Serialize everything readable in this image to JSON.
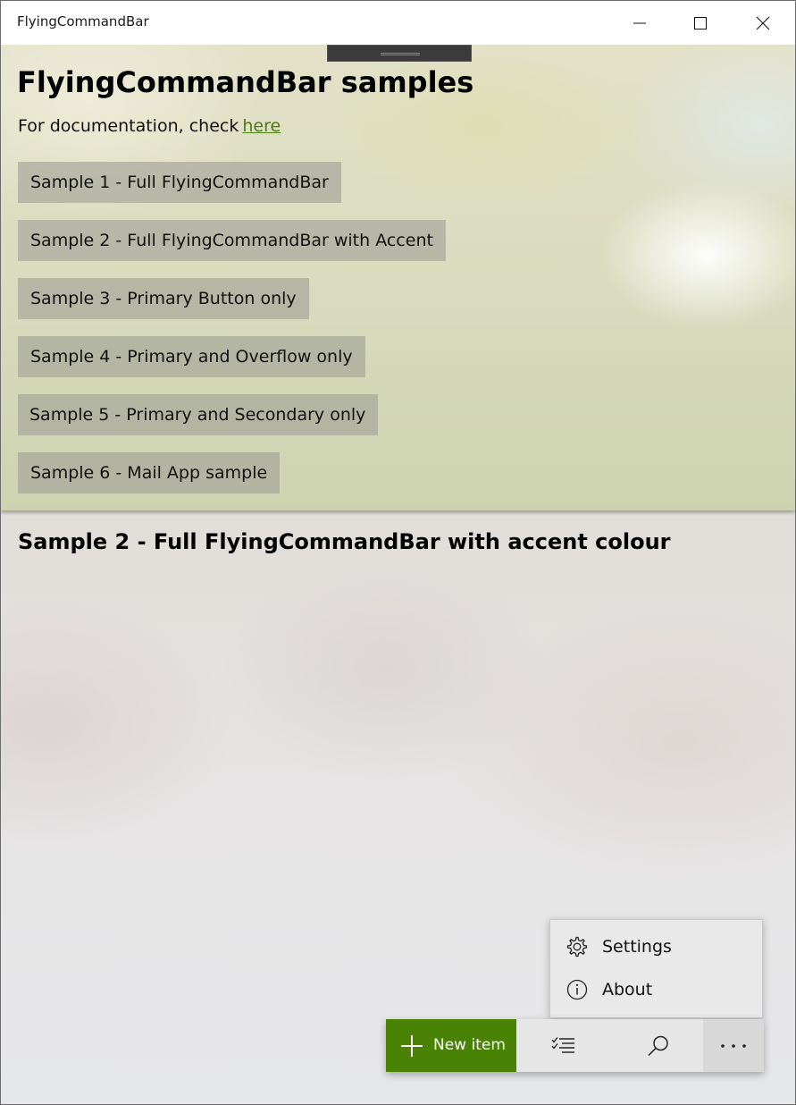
{
  "window": {
    "title": "FlyingCommandBar",
    "controls": [
      "minimize-icon",
      "maximize-icon",
      "close-icon"
    ]
  },
  "pane": {
    "heading": "FlyingCommandBar samples",
    "doc_prefix": "For documentation, check",
    "doc_link": "here",
    "samples": [
      "Sample 1 - Full FlyingCommandBar",
      "Sample 2 - Full FlyingCommandBar with Accent",
      "Sample 3 - Primary Button only",
      "Sample 4 - Primary and Overflow only",
      "Sample 5 - Primary and Secondary only",
      "Sample 6 - Mail App sample"
    ]
  },
  "content": {
    "section_title": "Sample 2 - Full FlyingCommandBar with accent colour"
  },
  "overflow_menu": {
    "items": [
      {
        "label": "Settings",
        "icon": "gear-icon"
      },
      {
        "label": "About",
        "icon": "info-icon"
      }
    ]
  },
  "command_bar": {
    "primary_label": "New item",
    "primary_icon": "plus-icon",
    "secondary_icons": [
      "checklist-icon",
      "search-icon",
      "more-icon"
    ]
  },
  "colors": {
    "accent": "#498205",
    "link": "#4b7d0e",
    "handle": "#3b3b3b"
  }
}
